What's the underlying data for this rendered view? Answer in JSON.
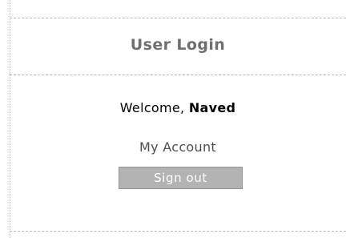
{
  "login_box": {
    "title": "User Login",
    "welcome_prefix": "Welcome, ",
    "username": "Naved",
    "my_account_label": "My Account",
    "sign_out_label": "Sign out"
  },
  "colors": {
    "title": "#6f6f6f",
    "button_bg": "#b3b3b3",
    "button_text": "#ffffff",
    "divider": "#b7b7b7"
  }
}
